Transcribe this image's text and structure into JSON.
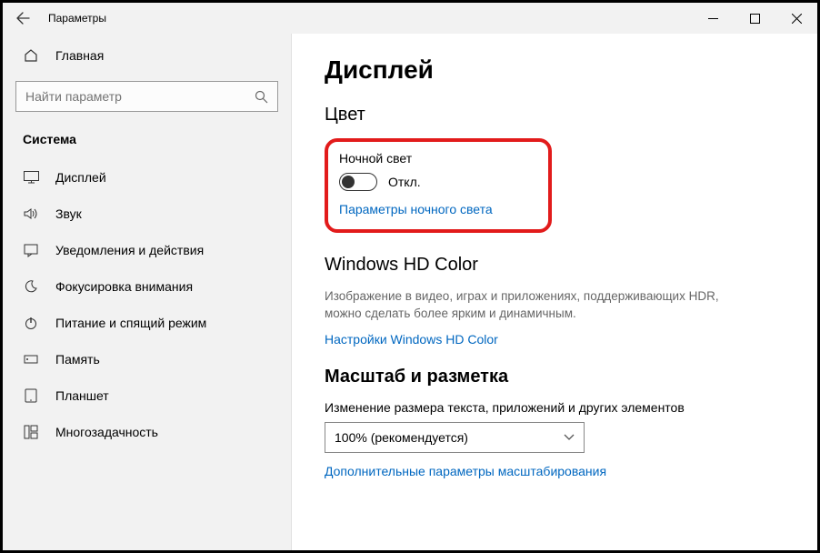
{
  "window": {
    "title": "Параметры"
  },
  "sidebar": {
    "home": "Главная",
    "search_placeholder": "Найти параметр",
    "section": "Система",
    "items": [
      {
        "label": "Дисплей"
      },
      {
        "label": "Звук"
      },
      {
        "label": "Уведомления и действия"
      },
      {
        "label": "Фокусировка внимания"
      },
      {
        "label": "Питание и спящий режим"
      },
      {
        "label": "Память"
      },
      {
        "label": "Планшет"
      },
      {
        "label": "Многозадачность"
      }
    ]
  },
  "page": {
    "title": "Дисплей",
    "color_heading": "Цвет",
    "night_light_label": "Ночной свет",
    "night_light_state": "Откл.",
    "night_light_link": "Параметры ночного света",
    "hd_heading": "Windows HD Color",
    "hd_desc": "Изображение в видео, играх и приложениях, поддерживающих HDR, можно сделать более ярким и динамичным.",
    "hd_link": "Настройки Windows HD Color",
    "scale_heading": "Масштаб и разметка",
    "scale_label": "Изменение размера текста, приложений и других элементов",
    "scale_value": "100% (рекомендуется)",
    "scale_link": "Дополнительные параметры масштабирования"
  }
}
